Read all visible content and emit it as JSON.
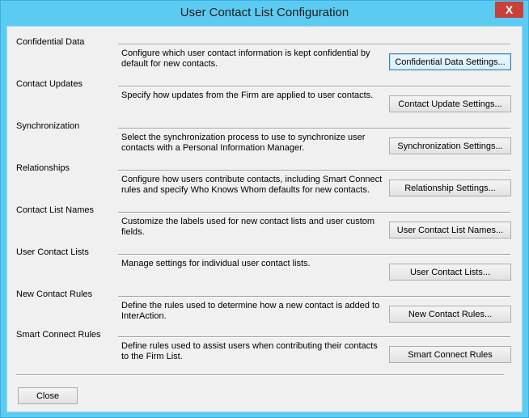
{
  "window": {
    "title": "User Contact List Configuration",
    "close_glyph": "X"
  },
  "sections": [
    {
      "label": "Confidential Data",
      "description": "Configure which user contact information is kept confidential by default for new contacts.",
      "button": "Confidential Data Settings..."
    },
    {
      "label": "Contact Updates",
      "description": "Specify how updates from the Firm are applied to user contacts.",
      "button": "Contact Update Settings..."
    },
    {
      "label": "Synchronization",
      "description": "Select the synchronization process to use to synchronize user contacts with a Personal Information Manager.",
      "button": "Synchronization Settings..."
    },
    {
      "label": "Relationships",
      "description": "Configure how users contribute contacts, including Smart Connect rules and specify Who Knows Whom defaults for new contacts.",
      "button": "Relationship Settings..."
    },
    {
      "label": "Contact List Names",
      "description": "Customize the labels used for new contact lists and user custom fields.",
      "button": "User Contact List Names..."
    },
    {
      "label": "User Contact Lists",
      "description": "Manage settings for individual user contact lists.",
      "button": "User Contact Lists..."
    },
    {
      "label": "New Contact Rules",
      "description": "Define the rules used to determine how a new contact is added to InterAction.",
      "button": "New Contact Rules..."
    },
    {
      "label": "Smart Connect Rules",
      "description": "Define rules used to assist users when contributing their contacts to the Firm List.",
      "button": "Smart Connect Rules"
    }
  ],
  "footer": {
    "close_label": "Close"
  },
  "colors": {
    "titlebar": "#5ccbf2",
    "close_button": "#c7403a",
    "dialog_background": "#f0f0f0"
  }
}
